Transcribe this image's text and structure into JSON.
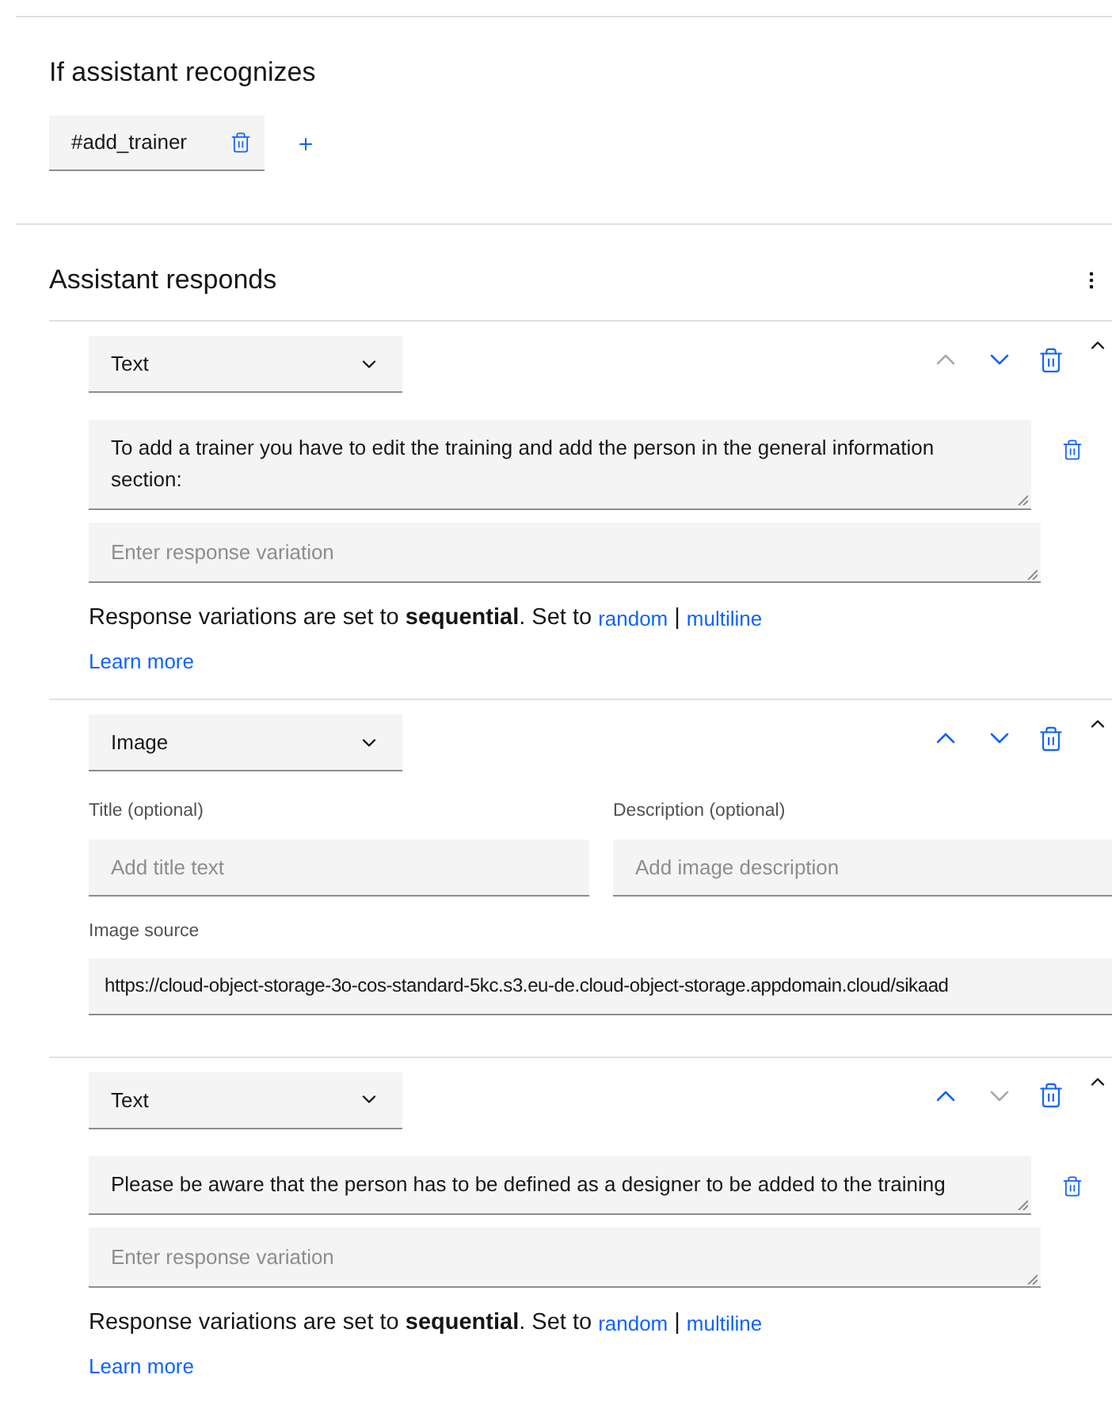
{
  "condition": {
    "heading": "If assistant recognizes",
    "intents": [
      {
        "label": "#add_trainer"
      }
    ]
  },
  "responses": {
    "heading": "Assistant responds",
    "blocks": [
      {
        "kind": "text",
        "type": "Text",
        "up_disabled": true,
        "down_disabled": false,
        "variations": [
          "To add a trainer you have to edit the training and add the person in the general information section:"
        ],
        "placeholder": "Enter response variation",
        "note": "Response variations are set to **sequential**. Set to",
        "links": [
          "random",
          "multiline"
        ],
        "separator": "|",
        "learn_more": "Learn more"
      },
      {
        "kind": "image",
        "type": "Image",
        "up_disabled": false,
        "down_disabled": false,
        "title_label": "Title (optional)",
        "title_placeholder": "Add title text",
        "description_label": "Description (optional)",
        "description_placeholder": "Add image description",
        "source_label": "Image source",
        "source_value": "https://cloud-object-storage-3o-cos-standard-5kc.s3.eu-de.cloud-object-storage.appdomain.cloud/sikaad"
      },
      {
        "kind": "text",
        "type": "Text",
        "up_disabled": false,
        "down_disabled": true,
        "variations": [
          "Please be aware that the person has to be defined as a designer to be added to the training"
        ],
        "placeholder": "Enter response variation",
        "note": "Response variations are set to **sequential**. Set to",
        "links": [
          "random",
          "multiline"
        ],
        "separator": "|",
        "learn_more": "Learn more"
      }
    ]
  }
}
